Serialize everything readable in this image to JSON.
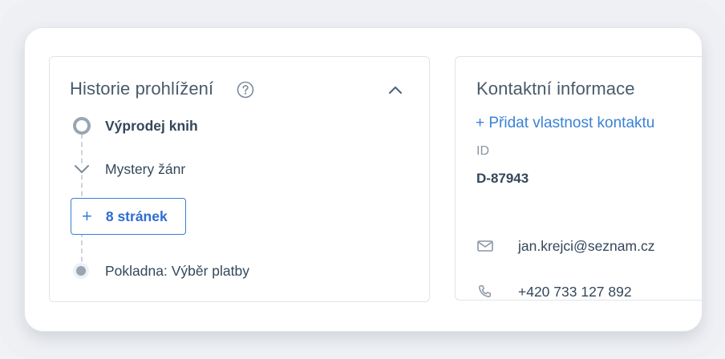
{
  "history": {
    "title": "Historie prohlížení",
    "entries": [
      {
        "label": "Výprodej knih"
      },
      {
        "label": "Mystery žánr"
      },
      {
        "label": "Pokladna: Výběr platby"
      }
    ],
    "pages_button": {
      "plus": "+",
      "label": "8 stránek"
    }
  },
  "contact": {
    "title": "Kontaktní informace",
    "add_property": "+ Přidat vlastnost kontaktu",
    "id_label": "ID",
    "id_value": "D-87943",
    "email": "jan.krejci@seznam.cz",
    "phone": "+420 733 127 892"
  },
  "colors": {
    "accent": "#3b7fd6",
    "text": "#33475b",
    "muted": "#99a5b3"
  },
  "icons": [
    "help-icon",
    "chevron-up-icon",
    "chevron-down-icon",
    "plus-icon",
    "envelope-icon",
    "phone-icon"
  ]
}
